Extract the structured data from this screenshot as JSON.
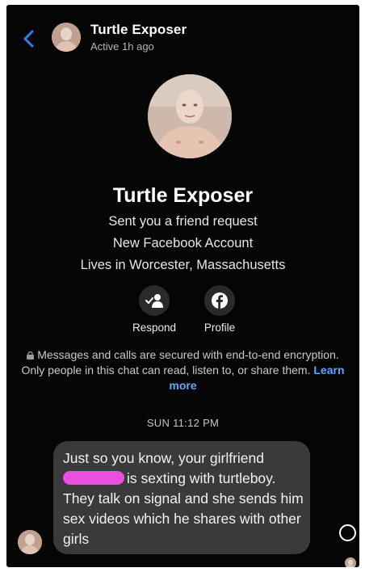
{
  "header": {
    "name": "Turtle Exposer",
    "status": "Active 1h ago"
  },
  "profile": {
    "name": "Turtle Exposer",
    "line1": "Sent you a friend request",
    "line2": "New Facebook Account",
    "line3": "Lives in Worcester, Massachusetts",
    "actions": [
      {
        "label": "Respond",
        "icon": "person-check-icon"
      },
      {
        "label": "Profile",
        "icon": "facebook-icon"
      }
    ]
  },
  "encryption": {
    "text": "Messages and calls are secured with end-to-end encryption. Only people in this chat can read, listen to, or share them.",
    "link": "Learn more"
  },
  "timestamp": "SUN 11:12 PM",
  "message": {
    "line_start": "Just so you know, your girlfriend",
    "after_redaction": "is sexting with turtleboy.",
    "rest": "They talk on signal and she sends him sex videos which he shares with other girls"
  },
  "colors": {
    "background": "#050505",
    "bubble": "#3a3a3a",
    "link": "#5aa9ff",
    "back_arrow": "#2e7cf6",
    "redaction": "#ea4fe0"
  }
}
